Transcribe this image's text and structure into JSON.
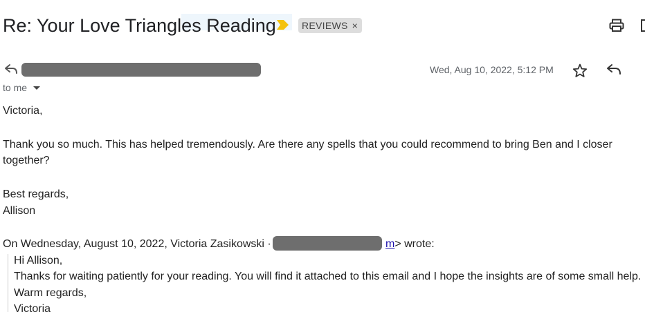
{
  "email": {
    "subject": "Re: Your Love Triangles Reading",
    "label_chip": "REVIEWS",
    "label_chip_close": "×",
    "to_line": "to me",
    "date": "Wed, Aug 10, 2022, 5:12 PM",
    "body": {
      "greeting": "Victoria,",
      "paragraph1_line1": "Thank you so much. This has helped tremendously. Are there any spells that you could recommend to bring Ben and I closer",
      "paragraph1_line2": "together?",
      "signoff": "Best regards,",
      "signature": "Allison"
    },
    "quoted": {
      "attribution_prefix": "On Wednesday, August 10, 2022, Victoria Zasikowski ·",
      "attribution_link_frag": "m",
      "attribution_suffix": "> wrote:",
      "line1": "Hi Allison,",
      "line2": "Thanks for waiting patiently for your reading. You will find it attached to this email and I hope the insights are of some small help.",
      "line3": "Warm regards,",
      "line4": "Victoria"
    }
  },
  "icons": {
    "importance": "importance-marker-icon",
    "print": "print-icon",
    "new_window": "open-in-new-window-icon",
    "reply_indicator": "reply-arrow-icon",
    "star": "star-icon",
    "reply": "reply-icon",
    "caret": "caret-down-icon"
  },
  "colors": {
    "importance": "#f4c20d",
    "chip_bg": "#dddddd",
    "redaction": "#6e6e6e",
    "link": "#1a0dab"
  }
}
